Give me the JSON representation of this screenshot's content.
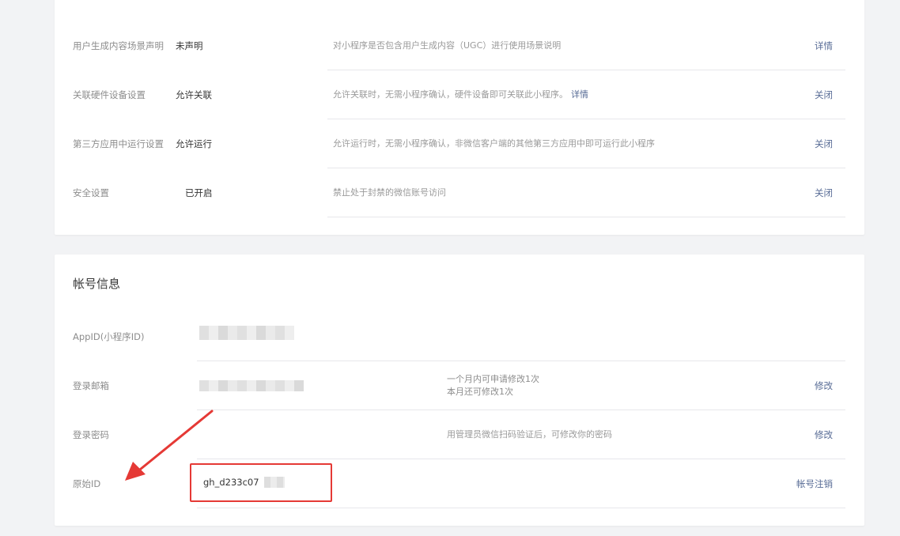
{
  "settings": {
    "rows": [
      {
        "label": "用户生成内容场景声明",
        "value": "未声明",
        "desc": "对小程序是否包含用户生成内容（UGC）进行使用场景说明",
        "desc_link": "",
        "action": "详情"
      },
      {
        "label": "关联硬件设备设置",
        "value": "允许关联",
        "desc": "允许关联时，无需小程序确认，硬件设备即可关联此小程序。",
        "desc_link": "详情",
        "action": "关闭"
      },
      {
        "label": "第三方应用中运行设置",
        "value": "允许运行",
        "desc": "允许运行时，无需小程序确认，非微信客户端的其他第三方应用中即可运行此小程序",
        "desc_link": "",
        "action": "关闭"
      },
      {
        "label": "安全设置",
        "value": "已开启",
        "desc": "禁止处于封禁的微信账号访问",
        "desc_link": "",
        "action": "关闭"
      }
    ]
  },
  "account": {
    "title": "帐号信息",
    "appid_label": "AppID(小程序ID)",
    "email_label": "登录邮箱",
    "email_desc_line1": "一个月内可申请修改1次",
    "email_desc_line2": "本月还可修改1次",
    "email_action": "修改",
    "password_label": "登录密码",
    "password_desc": "用管理员微信扫码验证后，可修改你的密码",
    "password_action": "修改",
    "orig_id_label": "原始ID",
    "orig_id_value": "gh_d233c07",
    "orig_id_action": "帐号注销"
  },
  "colors": {
    "link": "#576b95",
    "highlight": "#e53935",
    "background": "#f2f3f5"
  }
}
